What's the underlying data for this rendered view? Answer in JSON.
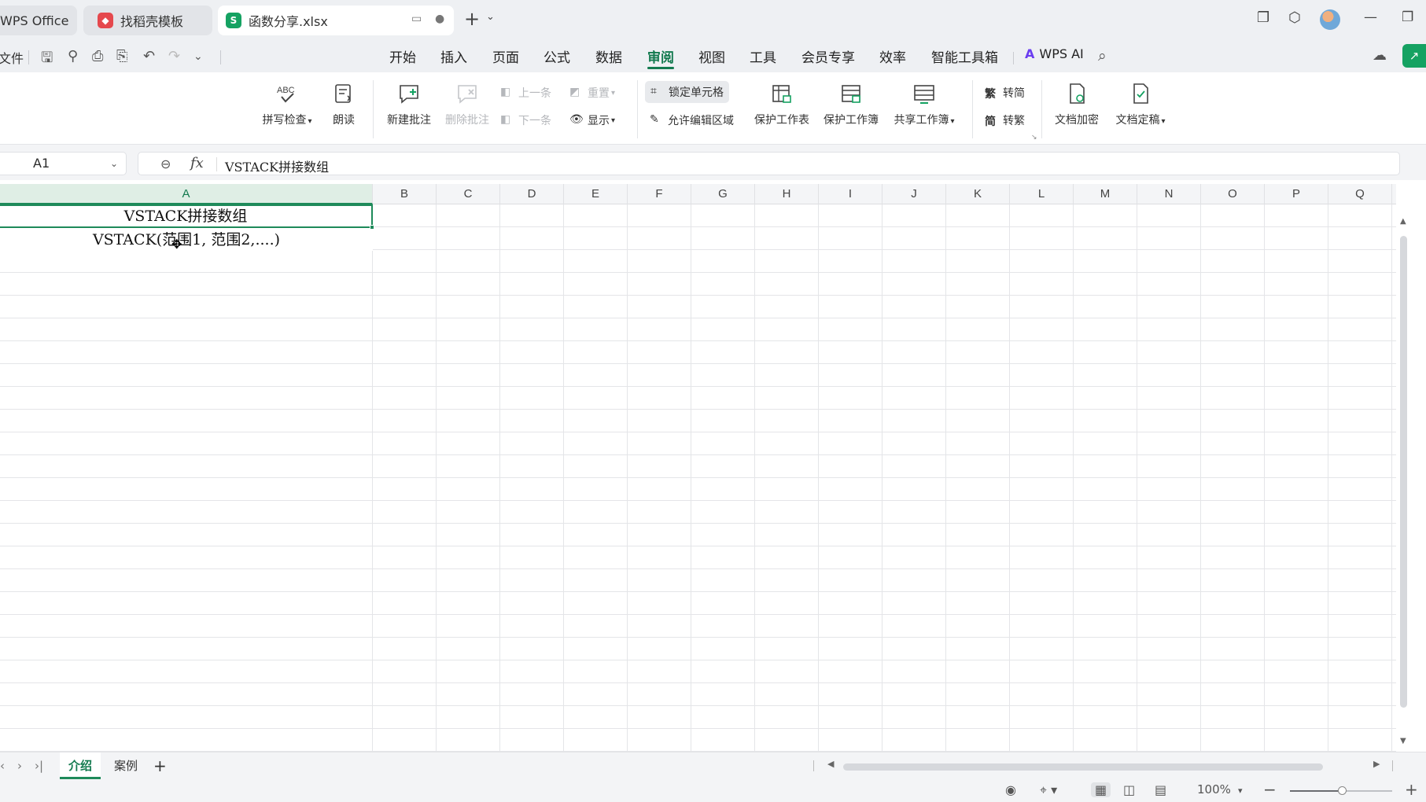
{
  "tabs": [
    {
      "label": "WPS Office"
    },
    {
      "label": "找稻壳模板"
    },
    {
      "label": "函数分享.xlsx"
    }
  ],
  "quick_access": {
    "file_label": "文件"
  },
  "menu": [
    "开始",
    "插入",
    "页面",
    "公式",
    "数据",
    "审阅",
    "视图",
    "工具",
    "会员专享",
    "效率",
    "智能工具箱"
  ],
  "menu_active": "审阅",
  "wps_ai": "WPS AI",
  "ribbon": {
    "spell_check": "拼写检查",
    "read_aloud": "朗读",
    "new_comment": "新建批注",
    "delete_comment": "删除批注",
    "prev": "上一条",
    "next": "下一条",
    "reset": "重置",
    "show": "显示",
    "lock_cell": "锁定单元格",
    "allow_edit_range": "允许编辑区域",
    "protect_sheet": "保护工作表",
    "protect_workbook": "保护工作簿",
    "share_workbook": "共享工作簿",
    "to_simplified": "转简",
    "to_traditional": "转繁",
    "encrypt_doc": "文档加密",
    "finalize_doc": "文档定稿"
  },
  "formula_bar": {
    "name_box": "A1",
    "fx": "fx",
    "content": "VSTACK拼接数组"
  },
  "columns": [
    "A",
    "B",
    "C",
    "D",
    "E",
    "F",
    "G",
    "H",
    "I",
    "J",
    "K",
    "L",
    "M",
    "N",
    "O",
    "P",
    "Q"
  ],
  "cells": {
    "A1": "VSTACK拼接数组",
    "A2": "VSTACK(范围1, 范围2,....)"
  },
  "sheets": [
    {
      "label": "介绍",
      "active": true
    },
    {
      "label": "案例",
      "active": false
    }
  ],
  "status": {
    "zoom": "100%"
  },
  "colors": {
    "accent": "#1e8a5a",
    "menu_active": "#137a4f",
    "chrome_bg": "#eef0f3"
  }
}
